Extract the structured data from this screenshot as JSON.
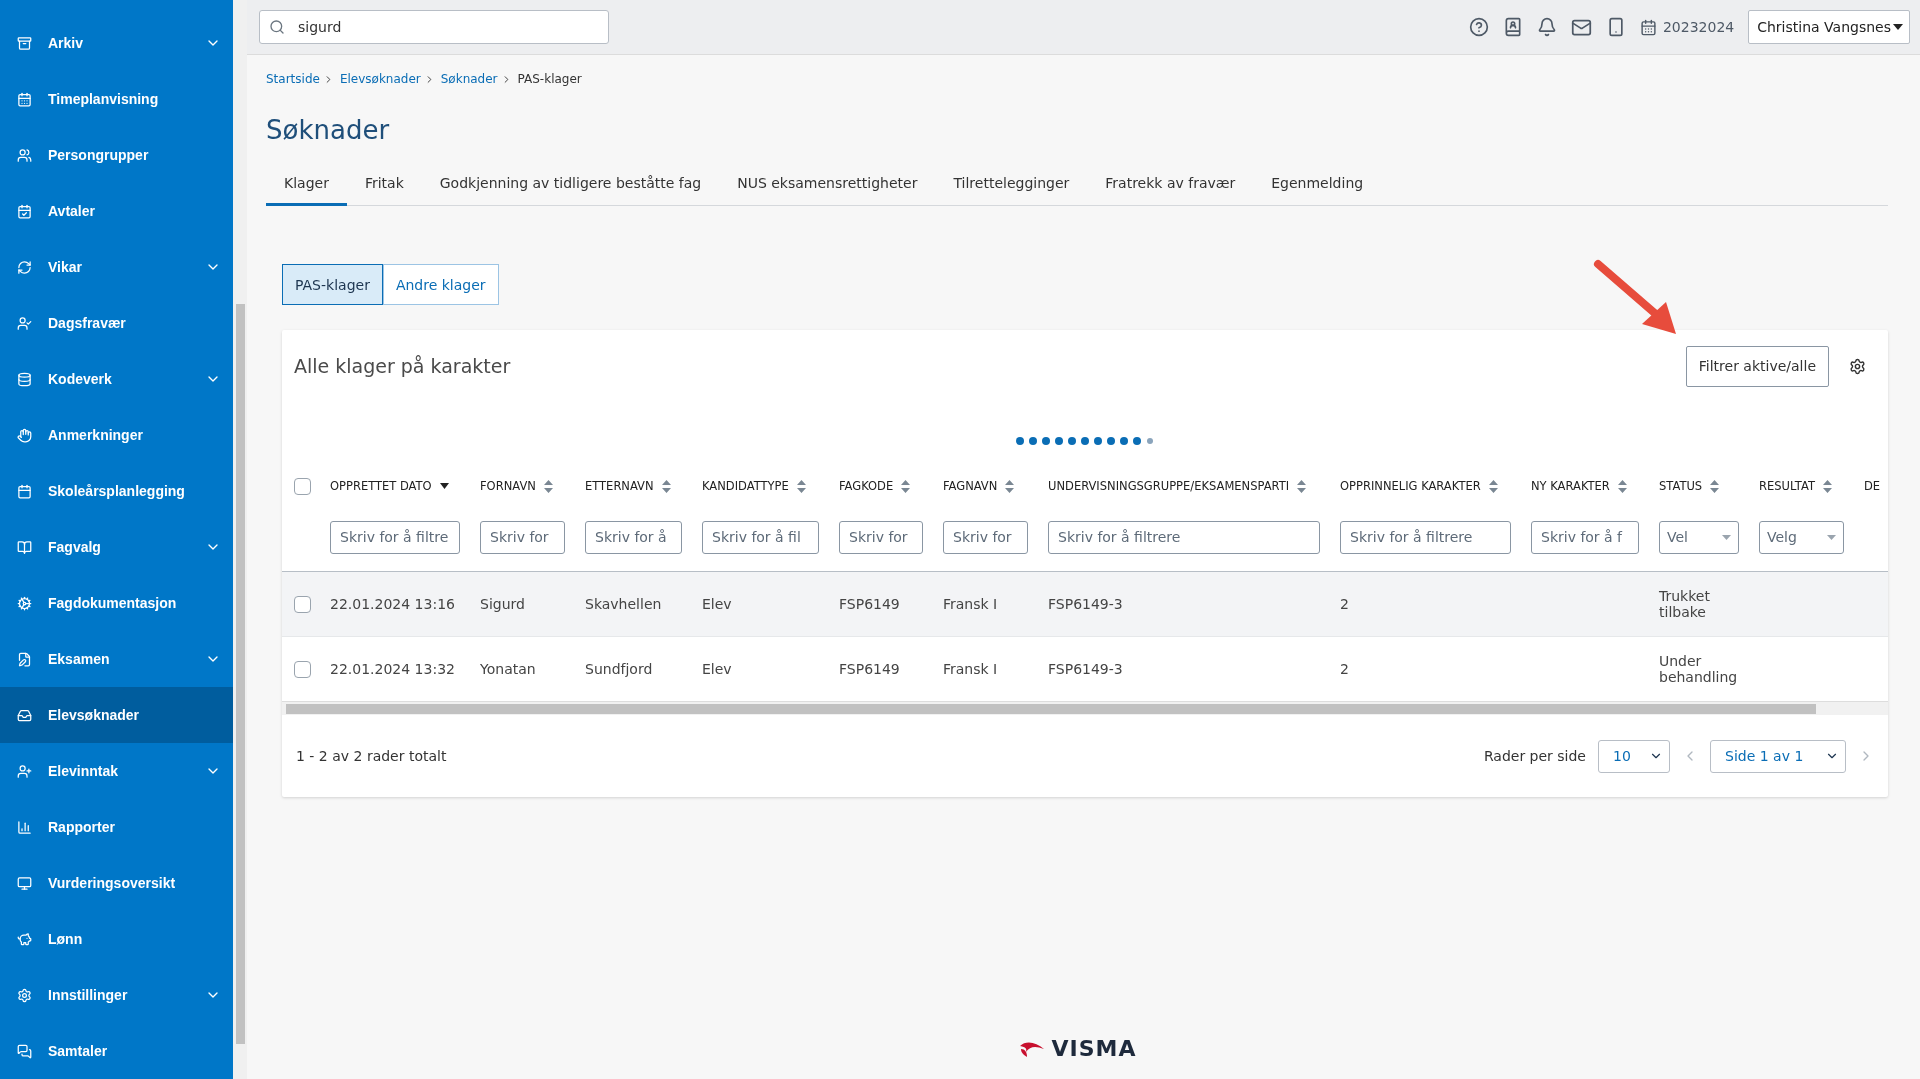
{
  "sidebar": {
    "items": [
      {
        "label": "Arkiv",
        "expandable": true,
        "selected": false
      },
      {
        "label": "Timeplanvisning",
        "expandable": false,
        "selected": false
      },
      {
        "label": "Persongrupper",
        "expandable": false,
        "selected": false
      },
      {
        "label": "Avtaler",
        "expandable": false,
        "selected": false
      },
      {
        "label": "Vikar",
        "expandable": true,
        "selected": false
      },
      {
        "label": "Dagsfravær",
        "expandable": false,
        "selected": false
      },
      {
        "label": "Kodeverk",
        "expandable": true,
        "selected": false
      },
      {
        "label": "Anmerkninger",
        "expandable": false,
        "selected": false
      },
      {
        "label": "Skoleårsplanlegging",
        "expandable": false,
        "selected": false
      },
      {
        "label": "Fagvalg",
        "expandable": true,
        "selected": false
      },
      {
        "label": "Fagdokumentasjon",
        "expandable": false,
        "selected": false
      },
      {
        "label": "Eksamen",
        "expandable": true,
        "selected": false
      },
      {
        "label": "Elevsøknader",
        "expandable": false,
        "selected": true
      },
      {
        "label": "Elevinntak",
        "expandable": true,
        "selected": false
      },
      {
        "label": "Rapporter",
        "expandable": false,
        "selected": false
      },
      {
        "label": "Vurderingsoversikt",
        "expandable": false,
        "selected": false
      },
      {
        "label": "Lønn",
        "expandable": false,
        "selected": false
      },
      {
        "label": "Innstillinger",
        "expandable": true,
        "selected": false
      },
      {
        "label": "Samtaler",
        "expandable": false,
        "selected": false
      }
    ]
  },
  "top_bar": {
    "search": {
      "value": "sigurd"
    },
    "school_year": "20232024",
    "user": "Christina Vangsnes"
  },
  "breadcrumbs": [
    {
      "label": "Startside",
      "current": false
    },
    {
      "label": "Elevsøknader",
      "current": false
    },
    {
      "label": "Søknader",
      "current": false
    },
    {
      "label": "PAS-klager",
      "current": true
    }
  ],
  "title": "Søknader",
  "tabs": [
    {
      "label": "Klager",
      "selected": true
    },
    {
      "label": "Fritak",
      "selected": false
    },
    {
      "label": "Godkjenning av tidligere beståtte fag",
      "selected": false
    },
    {
      "label": "NUS eksamensrettigheter",
      "selected": false
    },
    {
      "label": "Tilrettelegginger",
      "selected": false
    },
    {
      "label": "Fratrekk av fravær",
      "selected": false
    },
    {
      "label": "Egenmelding",
      "selected": false
    }
  ],
  "sub_tabs": [
    {
      "label": "PAS-klager",
      "selected": true
    },
    {
      "label": "Andre klager",
      "selected": false
    }
  ],
  "table": {
    "title": "Alle klager på karakter",
    "filter_button": "Filtrer aktive/alle",
    "select_all": {
      "checked": false
    },
    "columns": [
      {
        "header": "OPPRETTET DATO",
        "sorted_descending": true,
        "filter": {
          "kind": "text",
          "placeholder": "Skriv for å filtre"
        }
      },
      {
        "header": "FORNAVN",
        "sorted_descending": false,
        "filter": {
          "kind": "text",
          "placeholder": "Skriv for"
        }
      },
      {
        "header": "ETTERNAVN",
        "sorted_descending": false,
        "filter": {
          "kind": "text",
          "placeholder": "Skriv for å"
        }
      },
      {
        "header": "KANDIDATTYPE",
        "sorted_descending": false,
        "filter": {
          "kind": "text",
          "placeholder": "Skriv for å fil"
        }
      },
      {
        "header": "FAGKODE",
        "sorted_descending": false,
        "filter": {
          "kind": "text",
          "placeholder": "Skriv for"
        }
      },
      {
        "header": "FAGNAVN",
        "sorted_descending": false,
        "filter": {
          "kind": "text",
          "placeholder": "Skriv for"
        }
      },
      {
        "header": "UNDERVISNINGSGRUPPE/EKSAMENSPARTI",
        "sorted_descending": false,
        "filter": {
          "kind": "text",
          "placeholder": "Skriv for å filtrere"
        }
      },
      {
        "header": "OPPRINNELIG KARAKTER",
        "sorted_descending": false,
        "filter": {
          "kind": "text",
          "placeholder": "Skriv for å filtrere"
        }
      },
      {
        "header": "NY KARAKTER",
        "sorted_descending": false,
        "filter": {
          "kind": "text",
          "placeholder": "Skriv for å f"
        }
      },
      {
        "header": "STATUS",
        "sorted_descending": false,
        "filter": {
          "kind": "select",
          "placeholder": "Vel"
        }
      },
      {
        "header": "RESULTAT",
        "sorted_descending": false,
        "filter": {
          "kind": "select",
          "placeholder": "Velg"
        }
      },
      {
        "header": "DE"
      }
    ],
    "rows": [
      {
        "checked": false,
        "hovered": true,
        "cells": [
          "22.01.2024 13:16",
          "Sigurd",
          "Skavhellen",
          "Elev",
          "FSP6149",
          "Fransk I",
          "FSP6149-3",
          "2",
          "",
          "Trukket tilbake",
          ""
        ]
      },
      {
        "checked": false,
        "hovered": false,
        "cells": [
          "22.01.2024 13:32",
          "Yonatan",
          "Sundfjord",
          "Elev",
          "FSP6149",
          "Fransk I",
          "FSP6149-3",
          "2",
          "",
          "Under behandling",
          ""
        ]
      }
    ],
    "summary": "1 - 2 av 2 rader totalt",
    "rows_per_page_label": "Rader per side",
    "rows_per_page": "10",
    "page": "Side 1 av 1"
  },
  "footer_logo": "VISMA"
}
